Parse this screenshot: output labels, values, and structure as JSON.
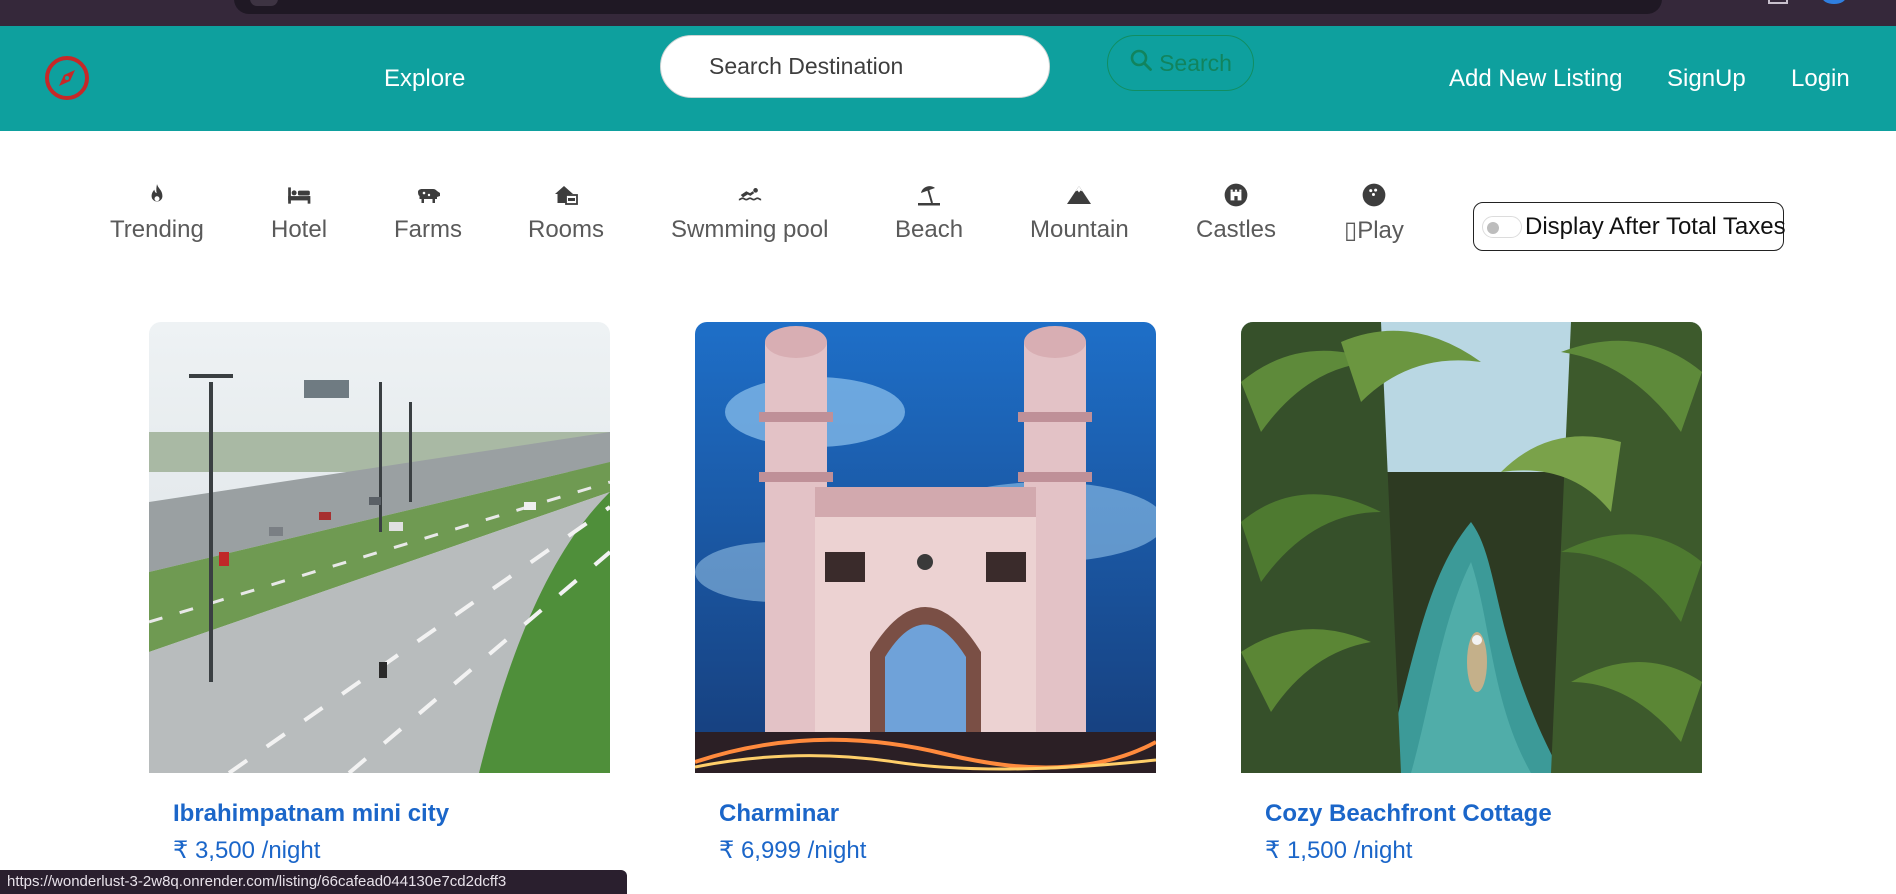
{
  "colors": {
    "navbar_bg": "#0ea09e",
    "link_blue": "#1b66c9",
    "search_green": "#11845e",
    "logo_red": "#c62828"
  },
  "navbar": {
    "logo_icon": "compass-icon",
    "explore_label": "Explore",
    "search_placeholder": "Search Destination",
    "search_button_label": "Search",
    "search_icon": "magnifier-icon",
    "add_listing_label": "Add New Listing",
    "signup_label": "SignUp",
    "login_label": "Login"
  },
  "filters": {
    "items": [
      {
        "label": "Trending",
        "icon": "fire-icon"
      },
      {
        "label": "Hotel",
        "icon": "bed-icon"
      },
      {
        "label": "Farms",
        "icon": "cow-icon"
      },
      {
        "label": "Rooms",
        "icon": "house-icon"
      },
      {
        "label": "Swmming pool",
        "icon": "swimmer-icon"
      },
      {
        "label": "Beach",
        "icon": "umbrella-beach-icon"
      },
      {
        "label": "Mountain",
        "icon": "mountain-icon"
      },
      {
        "label": "Castles",
        "icon": "castle-icon"
      },
      {
        "label": "Play",
        "icon": "ball-icon"
      }
    ],
    "tax_toggle_label": "Display After Total Taxes",
    "tax_toggle_on": false
  },
  "listings": [
    {
      "title": "Ibrahimpatnam mini city",
      "price": "₹ 3,500 /night",
      "image": "highway-photo"
    },
    {
      "title": "Charminar",
      "price": "₹ 6,999 /night",
      "image": "charminar-photo"
    },
    {
      "title": "Cozy Beachfront Cottage",
      "price": "₹ 1,500 /night",
      "image": "palm-lagoon-photo"
    }
  ],
  "status_bar": {
    "url": "https://wonderlust-3-2w8q.onrender.com/listing/66cafead044130e7cd2dcff3"
  }
}
